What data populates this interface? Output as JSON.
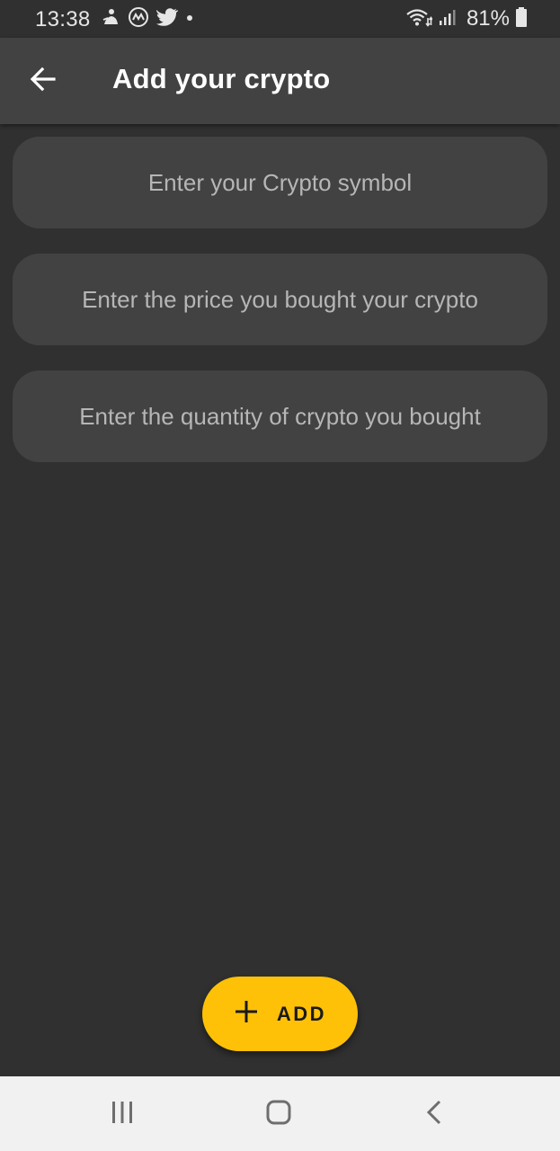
{
  "status_bar": {
    "time": "13:38",
    "battery_text": "81%",
    "icons_left": [
      "notification-app-icon",
      "coinmarketcap-icon",
      "twitter-icon",
      "dot-icon"
    ],
    "icons_right": [
      "wifi-icon",
      "signal-icon",
      "battery-icon"
    ]
  },
  "app_bar": {
    "title": "Add your crypto",
    "back_icon": "arrow-back-icon"
  },
  "form": {
    "symbol_field": {
      "value": "",
      "placeholder": "Enter your Crypto symbol"
    },
    "price_field": {
      "value": "",
      "placeholder": "Enter the price you bought your crypto"
    },
    "quantity_field": {
      "value": "",
      "placeholder": "Enter the quantity of crypto you bought"
    }
  },
  "fab": {
    "label": "ADD",
    "icon": "plus-icon"
  },
  "nav_bar": {
    "items": [
      "recent-apps-icon",
      "home-icon",
      "back-icon"
    ]
  },
  "colors": {
    "background": "#303030",
    "app_bar": "#424242",
    "field": "#424242",
    "accent": "#ffc107",
    "nav_bar": "#f1f1f1"
  }
}
